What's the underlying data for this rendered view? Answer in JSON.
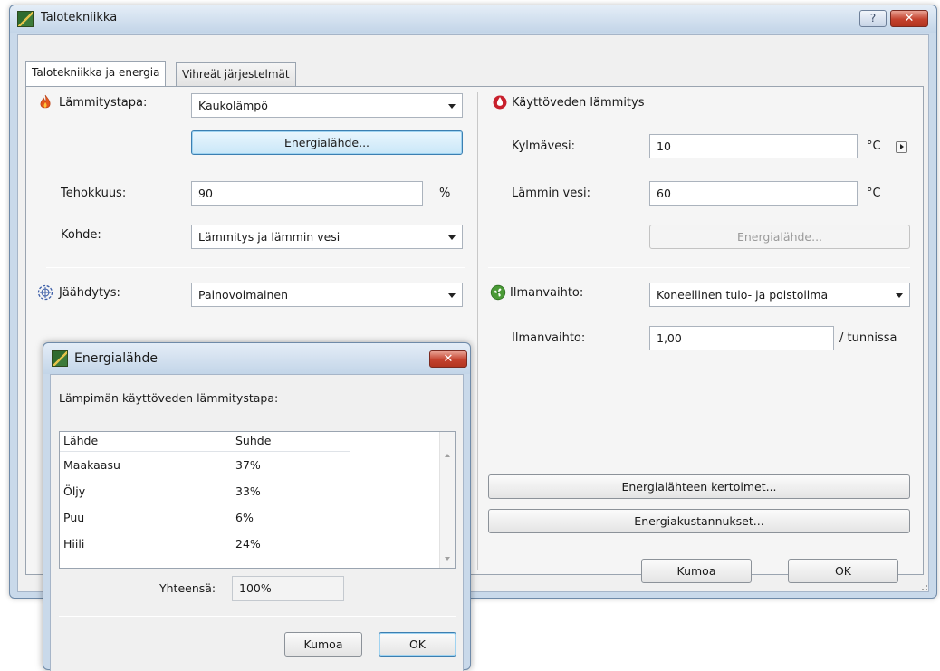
{
  "main_window": {
    "title": "Talotekniikka",
    "help_label": "?",
    "close_label": "✕",
    "tabs": [
      {
        "label": "Talotekniikka ja energia",
        "active": true
      },
      {
        "label": "Vihreät järjestelmät",
        "active": false
      }
    ],
    "heating": {
      "label": "Lämmitystapa:",
      "value": "Kaukolämpö",
      "energy_source_button": "Energialähde...",
      "efficiency_label": "Tehokkuus:",
      "efficiency_value": "90",
      "efficiency_unit": "%",
      "target_label": "Kohde:",
      "target_value": "Lämmitys ja lämmin vesi"
    },
    "cooling": {
      "label": "Jäähdytys:",
      "value": "Painovoimainen"
    },
    "hot_water": {
      "title": "Käyttöveden lämmitys",
      "cold_label": "Kylmävesi:",
      "cold_value": "10",
      "cold_unit": "°C",
      "warm_label": "Lämmin vesi:",
      "warm_value": "60",
      "warm_unit": "°C",
      "energy_source_button": "Energialähde..."
    },
    "ventilation": {
      "label": "Ilmanvaihto:",
      "value": "Koneellinen tulo- ja poistoilma",
      "rate_label": "Ilmanvaihto:",
      "rate_value": "1,00",
      "rate_unit": "/ tunnissa"
    },
    "energy_coefficients_button": "Energialähteen kertoimet...",
    "energy_costs_button": "Energiakustannukset...",
    "cancel_button": "Kumoa",
    "ok_button": "OK"
  },
  "energy_dialog": {
    "title": "Energialähde",
    "close_label": "✕",
    "description": "Lämpimän käyttöveden lämmitystapa:",
    "columns": [
      "Lähde",
      "Suhde"
    ],
    "rows": [
      {
        "source": "Maakaasu",
        "ratio": "37%"
      },
      {
        "source": "Öljy",
        "ratio": "33%"
      },
      {
        "source": "Puu",
        "ratio": "6%"
      },
      {
        "source": "Hiili",
        "ratio": "24%"
      }
    ],
    "total_label": "Yhteensä:",
    "total_value": "100%",
    "cancel_button": "Kumoa",
    "ok_button": "OK"
  },
  "colors": {
    "title_bar": "#c9d9ea",
    "close_button": "#c4422e",
    "focus_button": "#c9e7f8"
  },
  "icons": {
    "heating": "flame-icon",
    "cooling": "snowflake-icon",
    "hot_water": "water-drop-icon",
    "ventilation": "fan-icon",
    "app": "app-logo-icon"
  }
}
